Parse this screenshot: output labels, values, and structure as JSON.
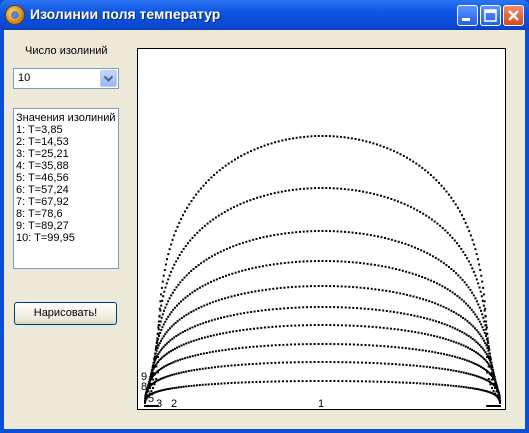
{
  "window": {
    "title": "Изолинии поля температур"
  },
  "controls": {
    "count_label": "Число изолиний",
    "count_value": "10",
    "values_title": "Значения изолиний",
    "values": [
      "1:  T=3,85",
      "2:  T=14,53",
      "3:  T=25,21",
      "4:  T=35,88",
      "5:  T=46,56",
      "6:  T=57,24",
      "7:  T=67,92",
      "8:  T=78,6",
      "9:  T=89,27",
      "10:  T=99,95"
    ],
    "draw_button": "Нарисовать!"
  },
  "plot": {
    "curve_labels": [
      "1",
      "2",
      "3",
      "5",
      "8",
      "9"
    ]
  }
}
